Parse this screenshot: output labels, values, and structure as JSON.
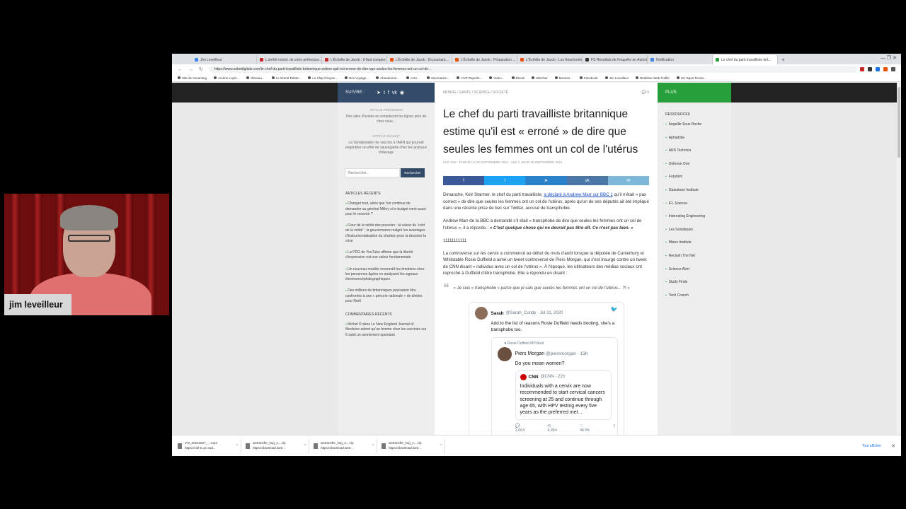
{
  "browser": {
    "tabs": [
      {
        "label": "Jim Leveilleur",
        "color": "#4285f4",
        "active": false
      },
      {
        "label": "L'arrêté minist. de votre préfecture...",
        "color": "#c62828",
        "active": false
      },
      {
        "label": "L'Échelle de Jacob : Il faut compter...",
        "color": "#c62828",
        "active": false
      },
      {
        "label": "L'Échelle de Jacob : Et pourtant...",
        "color": "#e65100",
        "active": false
      },
      {
        "label": "L'Échelle de Jacob : Préparation ...",
        "color": "#e65100",
        "active": false
      },
      {
        "label": "L'Échelle de Jacob : Les Anachorètes",
        "color": "#e65100",
        "active": false
      },
      {
        "label": "FS Résultats de l'enquête en Autriche",
        "color": "#333333",
        "active": false
      },
      {
        "label": "Notification",
        "color": "#4285f4",
        "active": false
      },
      {
        "label": "Le chef du parti travailliste brit...",
        "color": "#27a03b",
        "active": true
      }
    ],
    "new_tab": "+",
    "window_controls": "— ❐ ✕",
    "url": "https://www.subedigitale.com/le-chef-du-parti-travailliste-britannique-estime-quil-est-errone-de-dire-que-seules-les-femmes-ont-un-col-de...",
    "bookmarks": [
      "Site de streaming",
      "Arsène Lupin...",
      "Réseau...",
      "Le Grand Débat...",
      "Le Clap Citoyen...",
      "Bon Voyage...",
      "Abandonné...",
      "Actu...",
      "Vaccination...",
      "HVP Reports...",
      "Video...",
      "Ebook",
      "Marcher",
      "Bonnes...",
      "Facebook",
      "Jim Leveilleur",
      "Realtime Web Traffic",
      "US Open Tennis..."
    ]
  },
  "left_sidebar": {
    "follow_label": "SUIVRE :",
    "social_icons": [
      "telegram-icon",
      "twitter-icon",
      "facebook-icon",
      "vk-icon",
      "rss-icon"
    ],
    "prev_label": "Article précédent",
    "prev_title": "Des ailes d'avions en remplacent les lignes près de chez vous...",
    "next_label": "Article suivant",
    "next_title": "La Vandalisation de vaccins à l'ARN qui pourrait engendrer un effet de sauvegarde chez les animaux d'élevage",
    "search_placeholder": "Rechercher...",
    "search_button": "Rechercher",
    "recent_heading": "Articles récents",
    "recent_posts": [
      "Changer tout, alors que l'on continue de demander au général Milley si le budget vient aussi pour le recevoir ?",
      "Flour de la vérité des pouvoirs : la valeur du 'coût de la vérité' ; la gouvernance malgré les avantages d'instrumentalisation du charbon pour la dessiner la crise",
      "La PDG de YouTube affirme que la liberté d'expression est une valeur fondamentale",
      "Un nouveau modèle reconnaît les émotions chez les personnes âgées en analysant les signaux électroencéphalographiques",
      "Des millions de britanniques pourraient être confrontés à une « pénurie nationale » de dindes pour Noël"
    ],
    "comments_heading": "Commentaires récents",
    "recent_comment": "Michel D dans Le New England Journal of Medicine admet qu'un femme chez les vaccinés sur 6 subit un avortement spontané"
  },
  "article": {
    "categories": "MONDE / SANTÉ / SCIENCE / SOCIÉTÉ",
    "comment_count": "0",
    "title": "Le chef du parti travailliste britannique estime qu'il est « erroné » de dire que seules les femmes ont un col de l'utérus",
    "meta": "PAR JOE · PUBLIÉ LE 28 SEPTEMBRE 2021 · MIS À JOUR 28 SEPTEMBRE 2021",
    "share_buttons": [
      {
        "icon": "facebook-icon",
        "glyph": "f",
        "color": "#3b5998"
      },
      {
        "icon": "twitter-icon",
        "glyph": "t",
        "color": "#1da1f2"
      },
      {
        "icon": "telegram-icon",
        "glyph": "➤",
        "color": "#2c82c9"
      },
      {
        "icon": "vk-icon",
        "glyph": "vk",
        "color": "#4a76a8"
      },
      {
        "icon": "email-icon",
        "glyph": "✉",
        "color": "#7db8d8"
      }
    ],
    "para1_start": "Dimanche, Keir Starmer, le chef du parti travailliste, ",
    "para1_link": "a déclaré à Andrew Marr sur BBC 1",
    "para1_end": " qu'il n'était « pas correct » de dire que seules les femmes ont un col de l'utérus, après qu'un de ses députés ait été impliqué dans une récente prise de bec sur Twitter, accusé de transphobie.",
    "para2_start": "Andrew Marr de la BBC a demandé s'il était « transphobe de dire que seules les femmes ont un col de l'utérus », il a répondu : ",
    "para2_quote": "« C'est quelque chose qui ne devrait pas être dit. Ce n'est pas bien. »",
    "para3": "11111111111",
    "para4": "La controverse sur les cervix a commencé au début du mois d'août lorsque la députée de Canterbury et Whitstable Rosie Duffield a aimé un tweet controversé de Piers Morgan, qui s'est insurgé contre un tweet de CNN disant « individus avec un col de l'utérus ». À l'époque, les utilisateurs des médias sociaux ont reproché à Duffield d'être transphobe. Elle a répondu en disant :",
    "blockquote": "« Je suis « transphobe » parce que je sais que seules les femmes ont un col de l'utérus... ?! »"
  },
  "tweet": {
    "name": "Sarah",
    "handle": "@Sarah_Cundy · Jul 31, 2020",
    "text": "Add to the list of reasons Rosie Duffield needs booting, she's a transphobe too.",
    "quoted_rt": "♥ Rosie Duffield MP liked",
    "quoted_name": "Piers Morgan",
    "quoted_handle": "@piersmorgan · 13h",
    "quoted_text": "Do you mean women?",
    "cnn_name": "CNN",
    "cnn_handle": "@CNN · 22h",
    "cnn_text": "Individuals with a cervix are now recommended to start cervical cancers screening at 25 and continue through age 65, with HPV testing every five years as the preferred met...",
    "stats": [
      "1,664",
      "4,454",
      "46.5K"
    ]
  },
  "right_sidebar": {
    "plus_label": "PLUS",
    "resources_heading": "Ressources",
    "resources": [
      "Anguille Sous Roche",
      "Aphadolie",
      "ARS Technica",
      "Defense One",
      "Futurism",
      "Gatestone Institute",
      "IFL Science",
      "Interesting Engineering",
      "Les Sceptiques",
      "Mises Institute",
      "Reclaim The Net",
      "Science Alert",
      "Study Finds",
      "Tech Crunch"
    ]
  },
  "downloads": {
    "items": [
      {
        "name": "V.D_20210927_....mp4",
        "source": "https://ciel-tc.pc.sud..."
      },
      {
        "name": "wetransfer_img_2....zip",
        "source": "https://download.wetr..."
      },
      {
        "name": "wetransfer_img_2....zip",
        "source": "https://download.wetr..."
      },
      {
        "name": "wetransfer_img_2....zip",
        "source": "https://download.wetr..."
      }
    ],
    "show_all": "Tout afficher",
    "close": "✕"
  },
  "webcam": {
    "name": "jim leveilleur"
  }
}
